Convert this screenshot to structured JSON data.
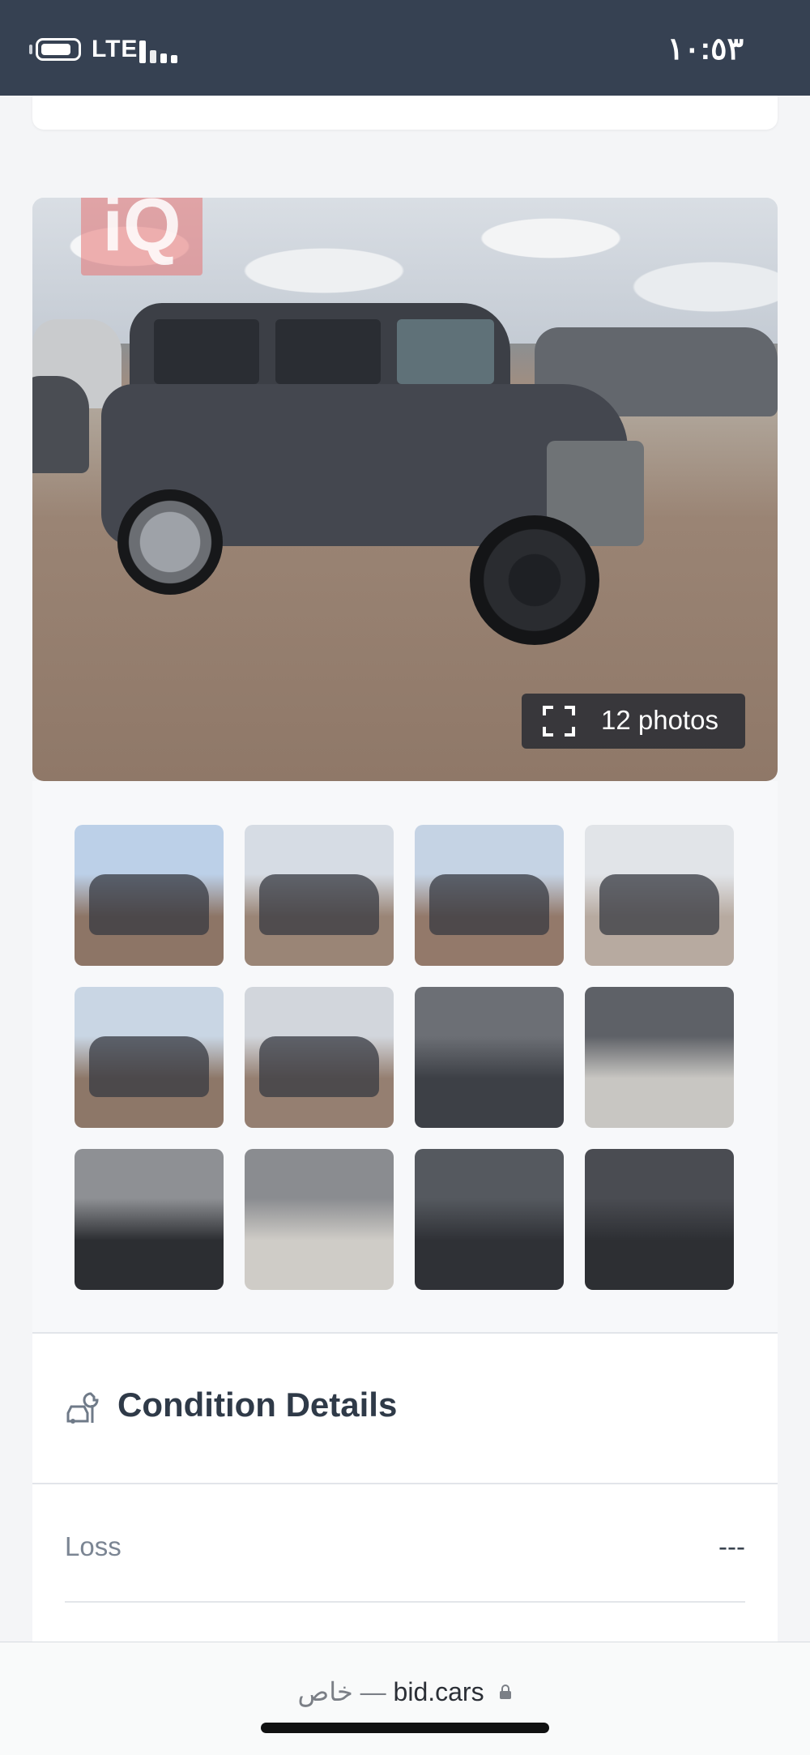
{
  "status_bar": {
    "network": "LTE",
    "time": "١٠:٥٣"
  },
  "main_photo": {
    "watermark": "iQ",
    "photo_count_label": "12 photos"
  },
  "thumbnails": [
    {
      "kind": "exterior-front-left",
      "sky": "#bcd0e8",
      "ground": "#8d7566"
    },
    {
      "kind": "exterior-rear-left",
      "sky": "#d6dce4",
      "ground": "#9a8576"
    },
    {
      "kind": "exterior-left",
      "sky": "#c5d3e4",
      "ground": "#93796a"
    },
    {
      "kind": "exterior-front-right",
      "sky": "#e1e4e8",
      "ground": "#b7aaa0"
    },
    {
      "kind": "exterior-front",
      "sky": "#c9d6e4",
      "ground": "#8d7768"
    },
    {
      "kind": "exterior-rear",
      "sky": "#d2d6dc",
      "ground": "#957f71"
    },
    {
      "kind": "interior-front-seats",
      "sky": "#6c6f75",
      "ground": "#3d4046"
    },
    {
      "kind": "interior-dashboard",
      "sky": "#5e6167",
      "ground": "#c8c6c2"
    },
    {
      "kind": "instrument-cluster",
      "sky": "#8e9094",
      "ground": "#2c2e32"
    },
    {
      "kind": "interior-rear-seats",
      "sky": "#8a8c90",
      "ground": "#cfccc7"
    },
    {
      "kind": "engine-bay",
      "sky": "#55595f",
      "ground": "#2f3136"
    },
    {
      "kind": "vin-label",
      "sky": "#4a4c52",
      "ground": "#2d2f33"
    }
  ],
  "condition": {
    "title": "Condition Details",
    "rows": [
      {
        "label": "Loss",
        "value": "---"
      }
    ]
  },
  "browser": {
    "private_label": "خاص",
    "separator": "—",
    "domain": "bid.cars"
  }
}
